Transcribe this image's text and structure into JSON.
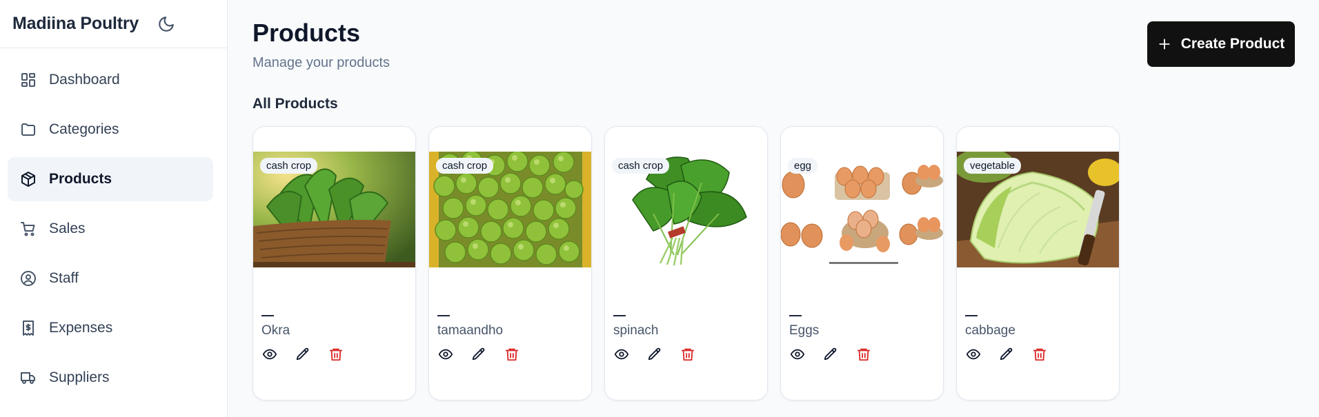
{
  "sidebar": {
    "brand": "Madiina Poultry",
    "theme_icon": "moon-icon",
    "items": [
      {
        "label": "Dashboard",
        "icon": "dashboard-icon",
        "active": false
      },
      {
        "label": "Categories",
        "icon": "folder-icon",
        "active": false
      },
      {
        "label": "Products",
        "icon": "package-icon",
        "active": true
      },
      {
        "label": "Sales",
        "icon": "cart-icon",
        "active": false
      },
      {
        "label": "Staff",
        "icon": "user-circle-icon",
        "active": false
      },
      {
        "label": "Expenses",
        "icon": "receipt-icon",
        "active": false
      },
      {
        "label": "Suppliers",
        "icon": "truck-icon",
        "active": false
      }
    ]
  },
  "header": {
    "title": "Products",
    "subtitle": "Manage your products",
    "create_label": "Create Product"
  },
  "section": {
    "title": "All Products"
  },
  "products": [
    {
      "tag": "cash crop",
      "dash": "—",
      "name": "Okra",
      "image": "okra-image"
    },
    {
      "tag": "cash crop",
      "dash": "—",
      "name": "tamaandho",
      "image": "tomato-image"
    },
    {
      "tag": "cash crop",
      "dash": "—",
      "name": "spinach",
      "image": "spinach-image"
    },
    {
      "tag": "egg",
      "dash": "—",
      "name": "Eggs",
      "image": "eggs-image"
    },
    {
      "tag": "vegetable",
      "dash": "—",
      "name": "cabbage",
      "image": "cabbage-image"
    }
  ],
  "colors": {
    "accent": "#111111",
    "delete": "#dc2626",
    "active_bg": "#f1f5f9"
  }
}
